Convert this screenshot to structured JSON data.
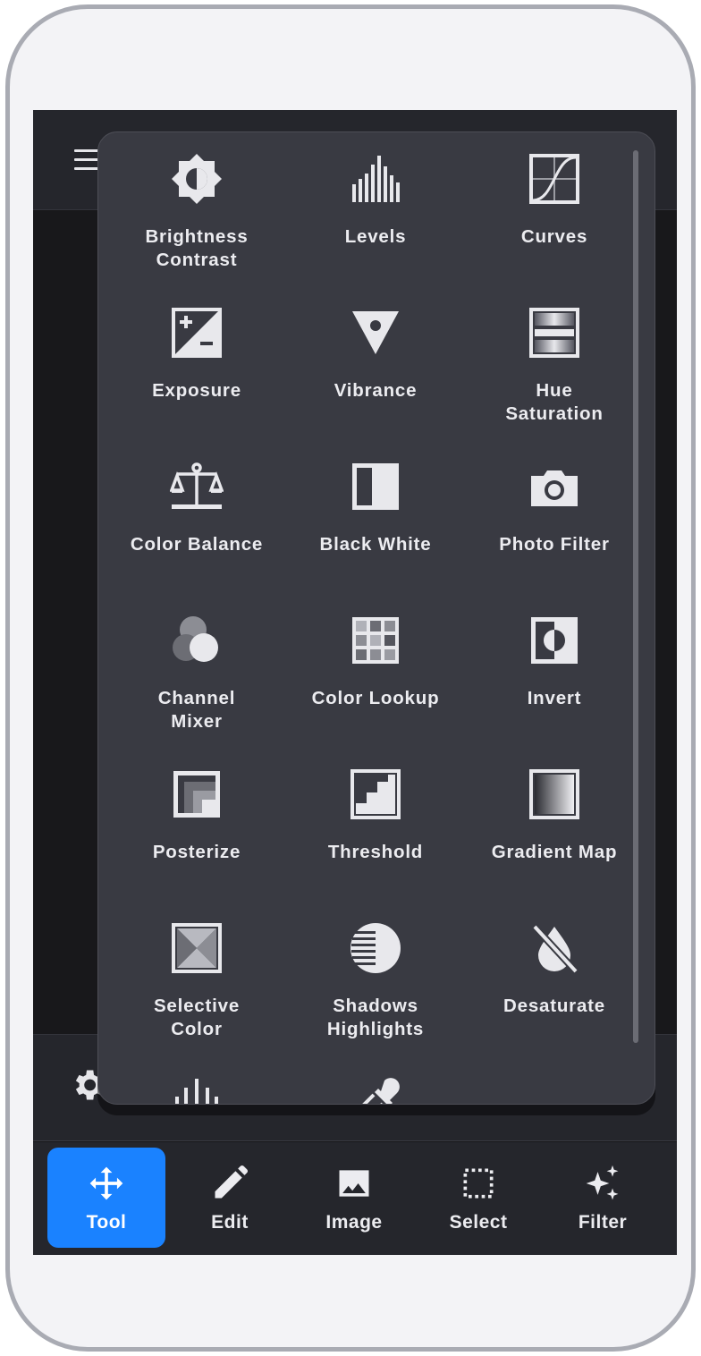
{
  "adjustments_menu": {
    "items": [
      {
        "label": "Brightness\nContrast",
        "icon": "brightness-contrast-icon"
      },
      {
        "label": "Levels",
        "icon": "levels-icon"
      },
      {
        "label": "Curves",
        "icon": "curves-icon"
      },
      {
        "label": "Exposure",
        "icon": "exposure-icon"
      },
      {
        "label": "Vibrance",
        "icon": "vibrance-icon"
      },
      {
        "label": "Hue\nSaturation",
        "icon": "hue-saturation-icon"
      },
      {
        "label": "Color Balance",
        "icon": "color-balance-icon"
      },
      {
        "label": "Black White",
        "icon": "black-white-icon"
      },
      {
        "label": "Photo Filter",
        "icon": "camera-icon"
      },
      {
        "label": "Channel\nMixer",
        "icon": "channel-mixer-icon"
      },
      {
        "label": "Color Lookup",
        "icon": "color-lookup-icon"
      },
      {
        "label": "Invert",
        "icon": "invert-icon"
      },
      {
        "label": "Posterize",
        "icon": "posterize-icon"
      },
      {
        "label": "Threshold",
        "icon": "threshold-icon"
      },
      {
        "label": "Gradient Map",
        "icon": "gradient-map-icon"
      },
      {
        "label": "Selective\nColor",
        "icon": "selective-color-icon"
      },
      {
        "label": "Shadows\nHighlights",
        "icon": "shadows-highlights-icon"
      },
      {
        "label": "Desaturate",
        "icon": "desaturate-icon"
      }
    ],
    "partial_items": [
      {
        "icon": "waveform-icon"
      },
      {
        "icon": "eyedropper-icon"
      }
    ]
  },
  "tabbar": {
    "tabs": [
      {
        "label": "Tool",
        "icon": "move-arrows-icon",
        "active": true
      },
      {
        "label": "Edit",
        "icon": "pencil-icon",
        "active": false
      },
      {
        "label": "Image",
        "icon": "image-icon",
        "active": false
      },
      {
        "label": "Select",
        "icon": "selection-marquee-icon",
        "active": false
      },
      {
        "label": "Filter",
        "icon": "sparkles-icon",
        "active": false
      }
    ]
  },
  "colors": {
    "accent": "#1a82ff",
    "menu_background": "#393a42",
    "bar_background": "#25262c",
    "text": "#ececf0"
  }
}
